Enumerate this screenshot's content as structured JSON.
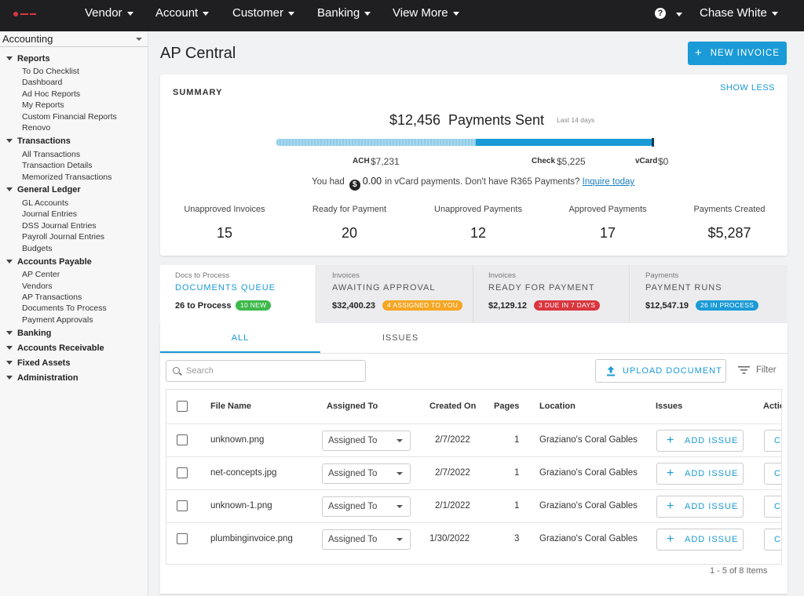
{
  "colors": {
    "accent": "#1a9ad6",
    "nav_bg": "#1f1f22",
    "green": "#3db94b",
    "orange": "#f5a623",
    "red": "#d9363e",
    "blue": "#1a9ad6"
  },
  "nav": {
    "items": [
      "Vendor",
      "Account",
      "Customer",
      "Banking",
      "View More"
    ],
    "user": "Chase White",
    "help_icon": "help-circle-icon"
  },
  "sidebar": {
    "module": "Accounting",
    "groups": [
      {
        "label": "Reports",
        "items": [
          "To Do Checklist",
          "Dashboard",
          "Ad Hoc Reports",
          "My Reports",
          "Custom Financial Reports",
          "Renovo"
        ]
      },
      {
        "label": "Transactions",
        "items": [
          "All Transactions",
          "Transaction Details",
          "Memorized Transactions"
        ]
      },
      {
        "label": "General Ledger",
        "items": [
          "GL Accounts",
          "Journal Entries",
          "DSS Journal Entries",
          "Payroll Journal Entries",
          "Budgets"
        ]
      },
      {
        "label": "Accounts Payable",
        "items": [
          "AP Center",
          "Vendors",
          "AP Transactions",
          "Documents To Process",
          "Payment Approvals"
        ]
      },
      {
        "label": "Banking",
        "items": []
      },
      {
        "label": "Accounts Receivable",
        "items": []
      },
      {
        "label": "Fixed Assets",
        "items": []
      },
      {
        "label": "Administration",
        "items": []
      }
    ]
  },
  "page": {
    "title": "AP Central",
    "new_invoice": "NEW INVOICE"
  },
  "summary": {
    "heading": "SUMMARY",
    "show_less": "SHOW LESS",
    "total": "$12,456",
    "total_label": "Payments Sent",
    "period": "Last 14 days",
    "ach_fraction": 0.53,
    "ach_label": "ACH",
    "ach_value": "$7,231",
    "check_label": "Check",
    "check_value": "$5,225",
    "vcard_label": "vCard",
    "vcard_value": "$0",
    "vcard_prefix": "You had",
    "vcard_amount": "0.00",
    "vcard_suffix": "in vCard payments. Don't have R365 Payments?",
    "vcard_link": "Inquire today",
    "stats": [
      {
        "label": "Unapproved Invoices",
        "value": "15"
      },
      {
        "label": "Ready for Payment",
        "value": "20"
      },
      {
        "label": "Unapproved Payments",
        "value": "12"
      },
      {
        "label": "Approved Payments",
        "value": "17"
      },
      {
        "label": "Payments Created",
        "value": "$5,287"
      }
    ]
  },
  "queue_tabs": [
    {
      "sub": "Docs to Process",
      "title": "DOCUMENTS QUEUE",
      "amount": "26 to Process",
      "badge": "10 NEW",
      "badge_color": "#3db94b"
    },
    {
      "sub": "Invoices",
      "title": "AWAITING APPROVAL",
      "amount": "$32,400.23",
      "badge": "4 ASSIGNED TO YOU",
      "badge_color": "#f5a623"
    },
    {
      "sub": "Invoices",
      "title": "READY FOR PAYMENT",
      "amount": "$2,129.12",
      "badge": "3 DUE IN 7 DAYS",
      "badge_color": "#d9363e"
    },
    {
      "sub": "Payments",
      "title": "PAYMENT RUNS",
      "amount": "$12,547.19",
      "badge": "26 IN PROCESS",
      "badge_color": "#1a9ad6"
    }
  ],
  "docs": {
    "tabs": [
      "ALL",
      "ISSUES"
    ],
    "search_placeholder": "Search",
    "upload": "UPLOAD DOCUMENT",
    "filter": "Filter",
    "columns": [
      "File Name",
      "Assigned To",
      "Created On",
      "Pages",
      "Location",
      "Issues",
      "Actio"
    ],
    "rows": [
      {
        "file": "unknown.png",
        "assigned": "Assigned To",
        "created": "2/7/2022",
        "pages": "1",
        "location": "Graziano's Coral Gables",
        "issue_btn": "ADD ISSUE",
        "action": "CI"
      },
      {
        "file": "net-concepts.jpg",
        "assigned": "Assigned To",
        "created": "2/7/2022",
        "pages": "1",
        "location": "Graziano's Coral Gables",
        "issue_btn": "ADD ISSUE",
        "action": "CI"
      },
      {
        "file": "unknown-1.png",
        "assigned": "Assigned To",
        "created": "2/1/2022",
        "pages": "1",
        "location": "Graziano's Coral Gables",
        "issue_btn": "ADD ISSUE",
        "action": "CI"
      },
      {
        "file": "plumbinginvoice.png",
        "assigned": "Assigned To",
        "created": "1/30/2022",
        "pages": "3",
        "location": "Graziano's Coral Gables",
        "issue_btn": "ADD ISSUE",
        "action": "CI"
      }
    ],
    "pagination": "1 - 5 of 8 Items"
  }
}
